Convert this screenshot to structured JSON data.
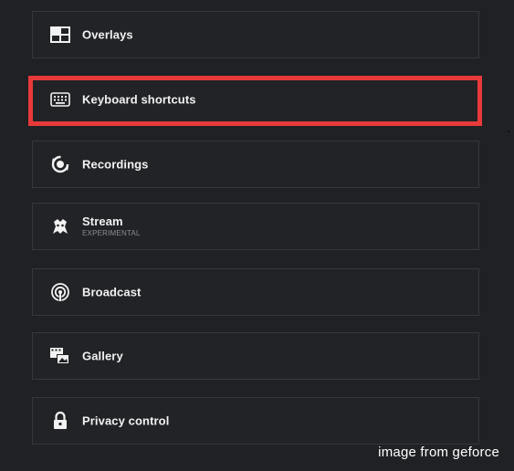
{
  "menu": {
    "items": [
      {
        "label": "Overlays",
        "icon": "overlays-icon"
      },
      {
        "label": "Keyboard shortcuts",
        "icon": "keyboard-icon",
        "highlighted": true
      },
      {
        "label": "Recordings",
        "icon": "recordings-icon"
      },
      {
        "label": "Stream",
        "sublabel": "EXPERIMENTAL",
        "icon": "stream-icon"
      },
      {
        "label": "Broadcast",
        "icon": "broadcast-icon"
      },
      {
        "label": "Gallery",
        "icon": "gallery-icon"
      },
      {
        "label": "Privacy control",
        "icon": "lock-icon"
      }
    ]
  },
  "highlight_color": "#e83a3a",
  "watermark": "image from geforce"
}
